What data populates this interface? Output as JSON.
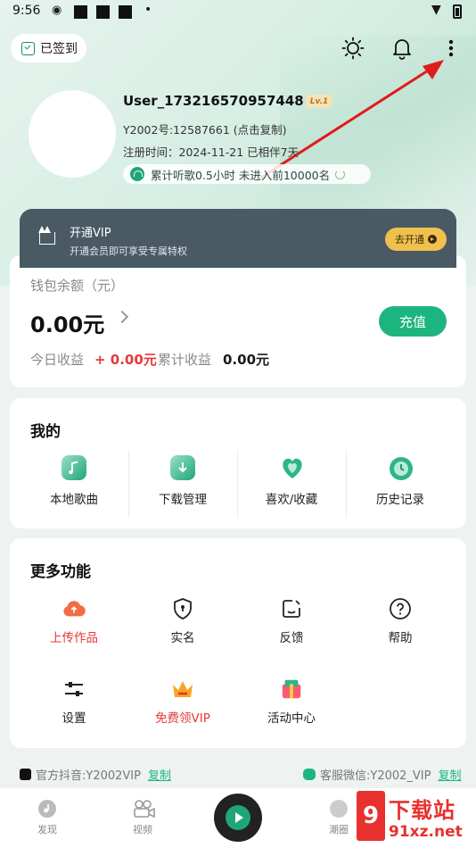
{
  "status_bar": {
    "time": "9:56",
    "weibo_icon": "weibo-icon",
    "dot": "•"
  },
  "header": {
    "signin_label": "已签到",
    "icons": [
      "brightness-icon",
      "bell-icon",
      "more-vert-icon"
    ]
  },
  "profile": {
    "username": "User_173216570957448",
    "level": "Lv.1",
    "id_line": "Y2002号:12587661 (点击复制)",
    "register_line": "注册时间：2024-11-21 已相伴7天",
    "listen_line": "累计听歌0.5小时 未进入前10000名"
  },
  "vip": {
    "title": "开通VIP",
    "subtitle": "开通会员即可享受专属特权",
    "button": "去开通"
  },
  "wallet": {
    "label": "钱包余额（元）",
    "amount": "0.00元",
    "recharge": "充值",
    "today_label": "今日收益",
    "today_value": "+ 0.00元",
    "total_label": "累计收益",
    "total_value": "0.00元"
  },
  "mine": {
    "title": "我的",
    "items": [
      {
        "label": "本地歌曲",
        "icon": "local-music-icon"
      },
      {
        "label": "下载管理",
        "icon": "download-icon"
      },
      {
        "label": "喜欢/收藏",
        "icon": "heart-icon"
      },
      {
        "label": "历史记录",
        "icon": "history-icon"
      }
    ]
  },
  "more": {
    "title": "更多功能",
    "items": [
      {
        "label": "上传作品",
        "icon": "upload-cloud-icon"
      },
      {
        "label": "实名",
        "icon": "shield-icon"
      },
      {
        "label": "反馈",
        "icon": "feedback-icon"
      },
      {
        "label": "帮助",
        "icon": "help-icon"
      },
      {
        "label": "设置",
        "icon": "settings-sliders-icon"
      },
      {
        "label": "免费领VIP",
        "icon": "crown-icon"
      },
      {
        "label": "活动中心",
        "icon": "gift-icon"
      }
    ]
  },
  "footer": {
    "douyin": "官方抖音:Y2002VIP",
    "douyin_copy": "复制",
    "wechat": "客服微信:Y2002_VIP",
    "wechat_copy": "复制"
  },
  "bottom_nav": {
    "items": [
      {
        "label": "发现",
        "icon": "discover-icon"
      },
      {
        "label": "视频",
        "icon": "video-icon"
      },
      {
        "label": "",
        "icon": "play-icon"
      },
      {
        "label": "潮圈",
        "icon": "circle-icon"
      }
    ]
  },
  "watermark": {
    "mark": "9",
    "text1": "下载站",
    "text2": "91xz.net"
  },
  "colors": {
    "accent": "#1db57f",
    "vip_bg": "#4a5a64",
    "vip_button": "#f0c04e",
    "red": "#e53935"
  }
}
